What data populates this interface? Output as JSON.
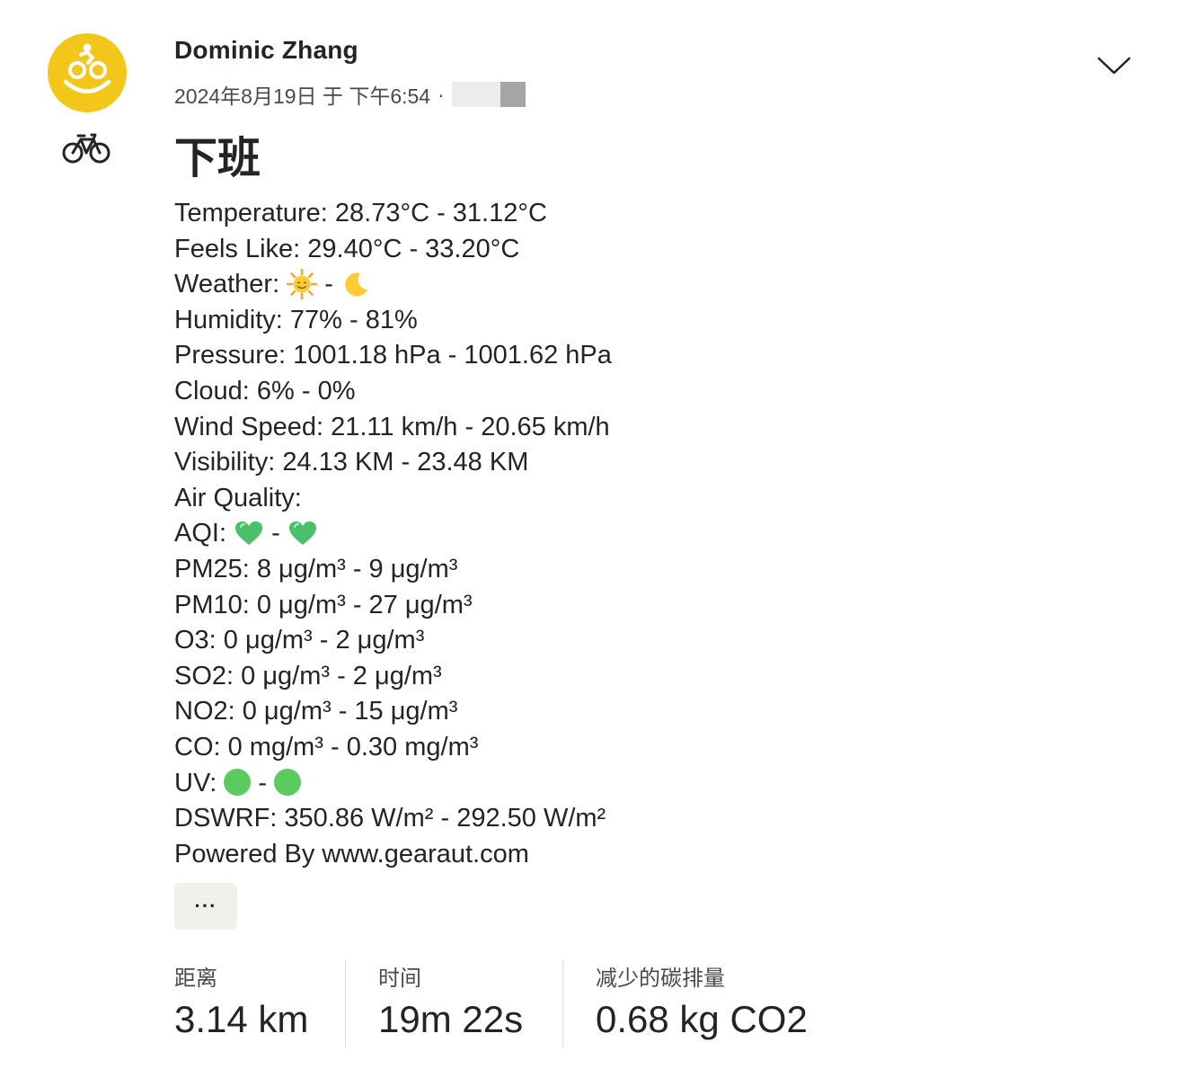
{
  "activity": {
    "athlete_name": "Dominic Zhang",
    "date_time": "2024年8月19日 于 下午6:54",
    "meta_separator": "·",
    "title": "下班",
    "sport_icon": "bicycle-icon",
    "avatar_icon": "cyclist-smile-icon"
  },
  "description": {
    "temperature": "Temperature: 28.73°C - 31.12°C",
    "feels_like": "Feels Like: 29.40°C - 33.20°C",
    "weather_label": "Weather:",
    "weather_separator": "-",
    "weather_start_icon": "sun-face-icon",
    "weather_end_icon": "crescent-moon-icon",
    "humidity": "Humidity: 77% - 81%",
    "pressure": "Pressure: 1001.18 hPa - 1001.62 hPa",
    "cloud": "Cloud: 6% - 0%",
    "wind_speed": "Wind Speed: 21.11 km/h - 20.65 km/h",
    "visibility": "Visibility: 24.13 KM - 23.48 KM",
    "air_quality": "Air Quality:",
    "aqi_label": "AQI:",
    "aqi_separator": "-",
    "aqi_icon": "green-heart-icon",
    "pm25": "PM25: 8 μg/m³ - 9 μg/m³",
    "pm10": "PM10: 0 μg/m³ - 27 μg/m³",
    "o3": "O3: 0 μg/m³ - 2 μg/m³",
    "so2": "SO2: 0 μg/m³ - 2 μg/m³",
    "no2": "NO2: 0 μg/m³ - 15 μg/m³",
    "co": "CO: 0 mg/m³ - 0.30 mg/m³",
    "uv_label": "UV:",
    "uv_separator": "-",
    "uv_icon": "green-circle-icon",
    "dswrf": "DSWRF: 350.86 W/m² - 292.50 W/m²",
    "powered_by": "Powered By www.gearaut.com"
  },
  "more_button": {
    "label": "···"
  },
  "stats": [
    {
      "label": "距离",
      "value": "3.14 km"
    },
    {
      "label": "时间",
      "value": "19m 22s"
    },
    {
      "label": "减少的碳排量",
      "value": "0.68 kg CO2"
    }
  ],
  "colors": {
    "avatar_bg": "#f2c71a",
    "text": "#242428",
    "muted_text": "#494950",
    "uv_green": "#5acb5f",
    "heart_green": "#4cbf6a",
    "more_button_bg": "#f0f0ed"
  }
}
